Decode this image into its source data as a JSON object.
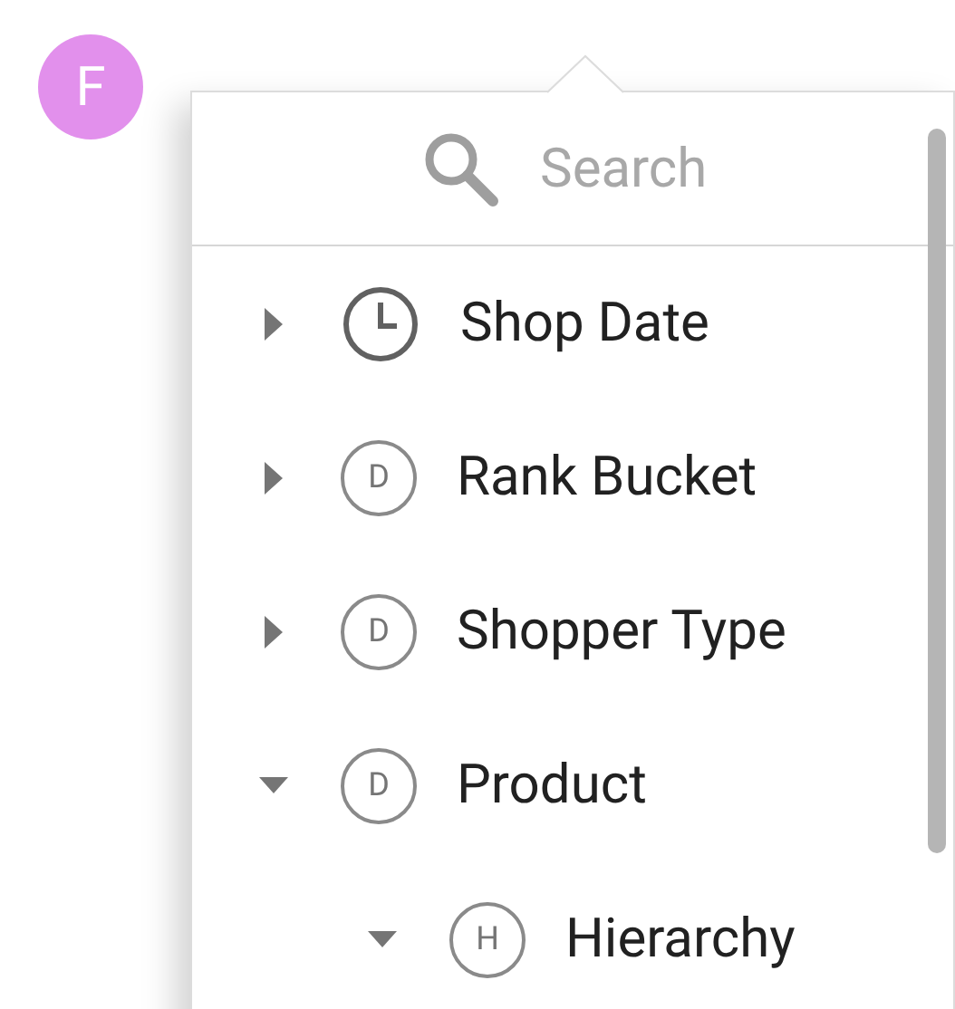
{
  "avatar": {
    "letter": "F",
    "color": "#e290ec"
  },
  "search": {
    "placeholder": "Search"
  },
  "tree": [
    {
      "kind": "time",
      "label": "Shop Date",
      "expanded": false
    },
    {
      "kind": "badge",
      "badge": "D",
      "label": "Rank Bucket",
      "expanded": false
    },
    {
      "kind": "badge",
      "badge": "D",
      "label": "Shopper Type",
      "expanded": false
    },
    {
      "kind": "badge",
      "badge": "D",
      "label": "Product",
      "expanded": true,
      "children": [
        {
          "kind": "badge",
          "badge": "H",
          "label": "Hierarchy",
          "expanded": true
        }
      ]
    }
  ]
}
